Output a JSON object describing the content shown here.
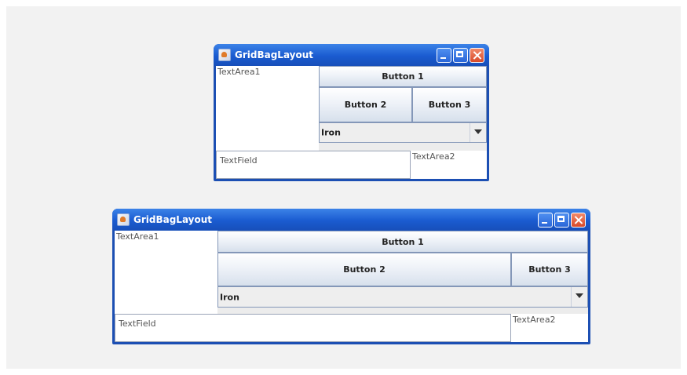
{
  "windows": [
    {
      "title": "GridBagLayout",
      "textarea1": "TextArea1",
      "button1": "Button 1",
      "button2": "Button 2",
      "button3": "Button 3",
      "combo_value": "Iron",
      "textfield": "TextField",
      "textarea2": "TextArea2"
    },
    {
      "title": "GridBagLayout",
      "textarea1": "TextArea1",
      "button1": "Button 1",
      "button2": "Button 2",
      "button3": "Button 3",
      "combo_value": "Iron",
      "textfield": "TextField",
      "textarea2": "TextArea2"
    }
  ],
  "icons": {
    "app": "java-cup-icon",
    "minimize": "minimize-icon",
    "maximize": "maximize-icon",
    "close": "close-icon",
    "dropdown": "chevron-down-icon"
  },
  "colors": {
    "title_bar": "#1a5bd0",
    "close_button": "#d84a2a",
    "content_bg": "#ececec"
  }
}
